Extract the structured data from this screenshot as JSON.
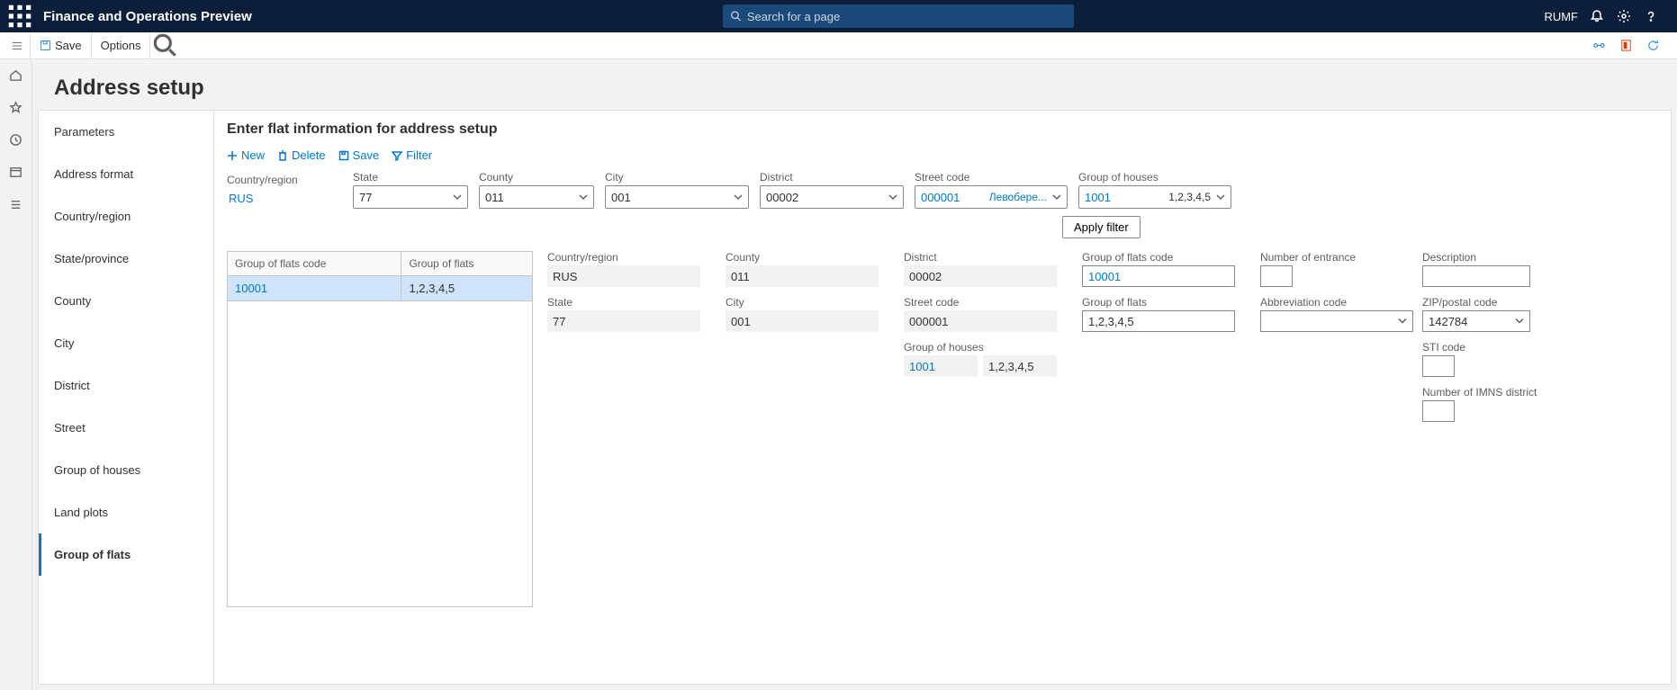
{
  "app": {
    "title": "Finance and Operations Preview",
    "user": "RUMF"
  },
  "search": {
    "placeholder": "Search for a page"
  },
  "actionbar": {
    "save": "Save",
    "options": "Options"
  },
  "page": {
    "title": "Address setup"
  },
  "tabs": [
    "Parameters",
    "Address format",
    "Country/region",
    "State/province",
    "County",
    "City",
    "District",
    "Street",
    "Group of houses",
    "Land plots",
    "Group of flats"
  ],
  "active_tab_index": 10,
  "section": {
    "title": "Enter flat information for address setup",
    "toolbar": {
      "new": "New",
      "delete": "Delete",
      "save": "Save",
      "filter": "Filter"
    }
  },
  "filters": {
    "country_region": {
      "label": "Country/region",
      "value": "RUS"
    },
    "state": {
      "label": "State",
      "value": "77"
    },
    "county": {
      "label": "County",
      "value": "011"
    },
    "city": {
      "label": "City",
      "value": "001"
    },
    "district": {
      "label": "District",
      "value": "00002"
    },
    "street_code": {
      "label": "Street code",
      "value": "000001",
      "extra": "Левобере..."
    },
    "group_of_houses": {
      "label": "Group of houses",
      "value": "1001",
      "extra": "1,2,3,4,5"
    },
    "apply": "Apply filter"
  },
  "grid": {
    "columns": [
      "Group of flats code",
      "Group of flats"
    ],
    "rows": [
      {
        "code": "10001",
        "flats": "1,2,3,4,5"
      }
    ]
  },
  "detail": {
    "country_region": {
      "label": "Country/region",
      "value": "RUS"
    },
    "county": {
      "label": "County",
      "value": "011"
    },
    "district": {
      "label": "District",
      "value": "00002"
    },
    "group_of_flats_code": {
      "label": "Group of flats code",
      "value": "10001"
    },
    "number_of_entrance": {
      "label": "Number of entrance",
      "value": ""
    },
    "description": {
      "label": "Description",
      "value": ""
    },
    "state": {
      "label": "State",
      "value": "77"
    },
    "city": {
      "label": "City",
      "value": "001"
    },
    "street_code": {
      "label": "Street code",
      "value": "000001"
    },
    "group_of_flats": {
      "label": "Group of flats",
      "value": "1,2,3,4,5"
    },
    "abbreviation_code": {
      "label": "Abbreviation code",
      "value": ""
    },
    "zip_postal_code": {
      "label": "ZIP/postal code",
      "value": "142784"
    },
    "group_of_houses": {
      "label": "Group of houses",
      "value": "1001",
      "extra": "1,2,3,4,5"
    },
    "sti_code": {
      "label": "STI code",
      "value": ""
    },
    "imns_district": {
      "label": "Number of IMNS district",
      "value": ""
    }
  }
}
